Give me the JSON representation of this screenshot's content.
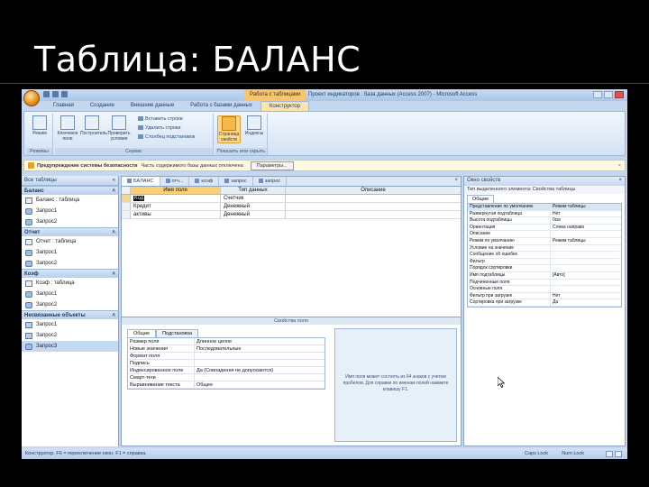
{
  "slide": {
    "title": "Таблица: БАЛАНС"
  },
  "app": {
    "context_tab": "Работа с таблицами",
    "window_title": "Проект индикаторов : база данных (Access 2007) - Microsoft Access",
    "ribbon_tabs": [
      "Главная",
      "Создание",
      "Внешние данные",
      "Работа с базами данных",
      "Конструктор"
    ],
    "ribbon": {
      "views_group": "Режимы",
      "view_label": "Режим",
      "tools_group": "Сервис",
      "key_label": "Ключевое поле",
      "builder_label": "Построитель",
      "test_label": "Проверить условия",
      "insert_rows": "Вставить строки",
      "delete_rows": "Удалить строки",
      "lookup_col": "Столбец подстановок",
      "showhide_group": "Показать или скрыть",
      "property_sheet_label": "Страница свойств",
      "indexes_label": "Индексы"
    },
    "security_bar": {
      "title": "Предупреждение системы безопасности",
      "message": "Часть содержимого базы данных отключена",
      "options_button": "Параметры..."
    },
    "nav": {
      "header": "Все таблицы",
      "groups": [
        {
          "name": "Баланс",
          "items": [
            "Баланс : таблица",
            "Запрос1",
            "Запрос2"
          ]
        },
        {
          "name": "Отчет",
          "items": [
            "Отчет : таблица",
            "Запрос1",
            "Запрос2"
          ]
        },
        {
          "name": "Коэф",
          "items": [
            "Коэф : таблица",
            "Запрос1",
            "Запрос2"
          ]
        },
        {
          "name": "Несвязанные объекты",
          "items": [
            "Запрос1",
            "Запрос2",
            "Запрос3"
          ]
        }
      ]
    },
    "doc_tabs": [
      "БАЛАНС",
      "отч...",
      "коэф",
      "запрос",
      "запрос"
    ],
    "grid": {
      "headers": [
        "Имя поля",
        "Тип данных",
        "Описание"
      ],
      "rows": [
        {
          "name": "Код",
          "type": "Счетчик"
        },
        {
          "name": "Кредит",
          "type": "Денежный"
        },
        {
          "name": "активы",
          "type": "Денежный"
        }
      ]
    },
    "field_props": {
      "title": "Свойства поля",
      "tabs": [
        "Общие",
        "Подстановка"
      ],
      "rows": [
        [
          "Размер поля",
          "Длинное целое"
        ],
        [
          "Новые значения",
          "Последовательные"
        ],
        [
          "Формат поля",
          ""
        ],
        [
          "Подпись",
          ""
        ],
        [
          "Индексированное поле",
          "Да (Совпадения не допускаются)"
        ],
        [
          "Смарт-теги",
          ""
        ],
        [
          "Выравнивание текста",
          "Общее"
        ]
      ],
      "hint": "Имя поля может состоять из 64 знаков с учетом пробелов. Для справки по именам полей нажмите клавишу F1."
    },
    "property_sheet": {
      "header": "Окно свойств",
      "selection": "Тип выделенного элемента: Свойства таблицы",
      "tab": "Общие",
      "rows": [
        [
          "Представление по умолчанию",
          "Режим таблицы"
        ],
        [
          "Развернутая подтаблица",
          "Нет"
        ],
        [
          "Высота подтаблицы",
          "0см"
        ],
        [
          "Ориентация",
          "Слева направо"
        ],
        [
          "Описание",
          ""
        ],
        [
          "Режим по умолчанию",
          "Режим таблицы"
        ],
        [
          "Условие на значение",
          ""
        ],
        [
          "Сообщение об ошибке",
          ""
        ],
        [
          "Фильтр",
          ""
        ],
        [
          "Порядок сортировки",
          ""
        ],
        [
          "Имя подтаблицы",
          "[Авто]"
        ],
        [
          "Подчиненные поля",
          ""
        ],
        [
          "Основные поля",
          ""
        ],
        [
          "Фильтр при загрузке",
          "Нет"
        ],
        [
          "Сортировка при загрузке",
          "Да"
        ]
      ]
    },
    "status": {
      "left": "Конструктор. F6 = переключение окон. F1 = справка.",
      "caps": "Caps Lock",
      "num": "Num Lock"
    }
  }
}
